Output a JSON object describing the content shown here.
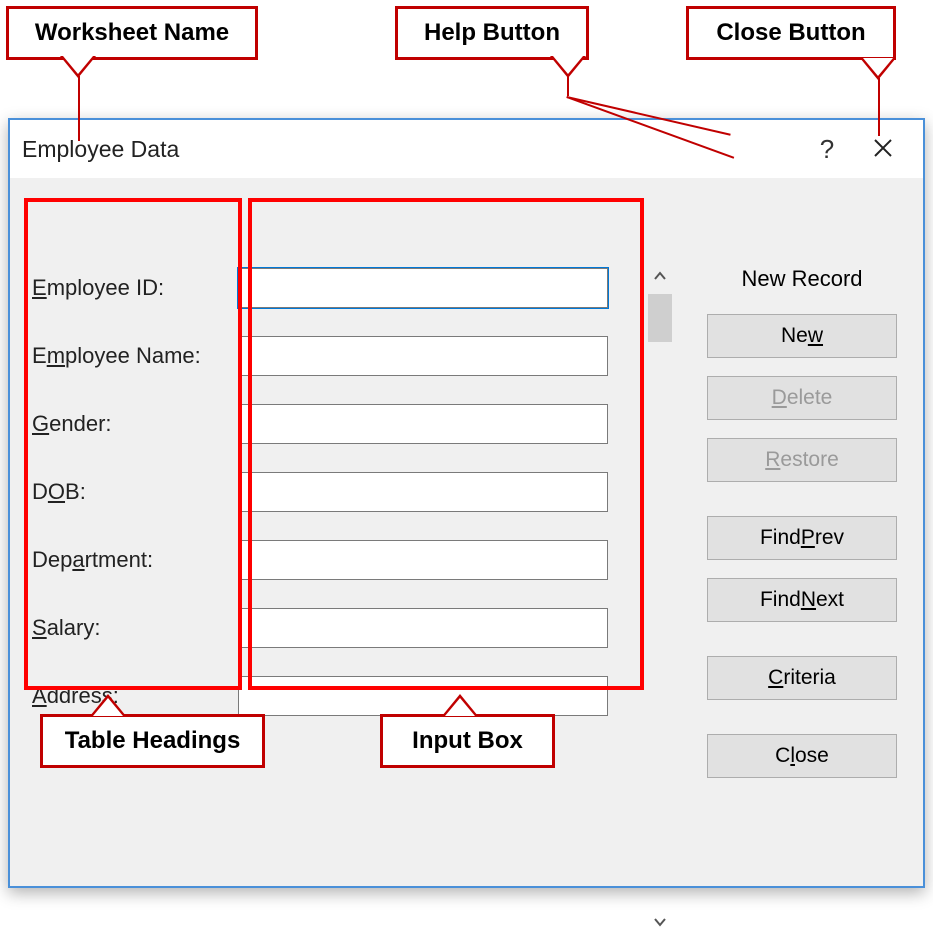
{
  "callouts": {
    "worksheet": "Worksheet Name",
    "help": "Help Button",
    "close": "Close Button",
    "tableHeadings": "Table Headings",
    "inputBox": "Input Box"
  },
  "dialog": {
    "title": "Employee Data",
    "recordStatus": "New Record",
    "fields": [
      {
        "labelPre": "",
        "accel": "E",
        "labelPost": "mployee ID:",
        "value": ""
      },
      {
        "labelPre": "E",
        "accel": "m",
        "labelPost": "ployee Name:",
        "value": ""
      },
      {
        "labelPre": "",
        "accel": "G",
        "labelPost": "ender:",
        "value": ""
      },
      {
        "labelPre": "D",
        "accel": "O",
        "labelPost": "B:",
        "value": ""
      },
      {
        "labelPre": "Dep",
        "accel": "a",
        "labelPost": "rtment:",
        "value": ""
      },
      {
        "labelPre": "",
        "accel": "S",
        "labelPost": "alary:",
        "value": ""
      },
      {
        "labelPre": "",
        "accel": "A",
        "labelPost": "ddress:",
        "value": ""
      }
    ],
    "buttons": {
      "new": {
        "pre": "Ne",
        "accel": "w",
        "post": "",
        "disabled": false
      },
      "delete": {
        "pre": "",
        "accel": "D",
        "post": "elete",
        "disabled": true
      },
      "restore": {
        "pre": "",
        "accel": "R",
        "post": "estore",
        "disabled": true
      },
      "findPrev": {
        "pre": "Find ",
        "accel": "P",
        "post": "rev",
        "disabled": false
      },
      "findNext": {
        "pre": "Find ",
        "accel": "N",
        "post": "ext",
        "disabled": false
      },
      "criteria": {
        "pre": "",
        "accel": "C",
        "post": "riteria",
        "disabled": false
      },
      "close": {
        "pre": "C",
        "accel": "l",
        "post": "ose",
        "disabled": false
      }
    }
  }
}
